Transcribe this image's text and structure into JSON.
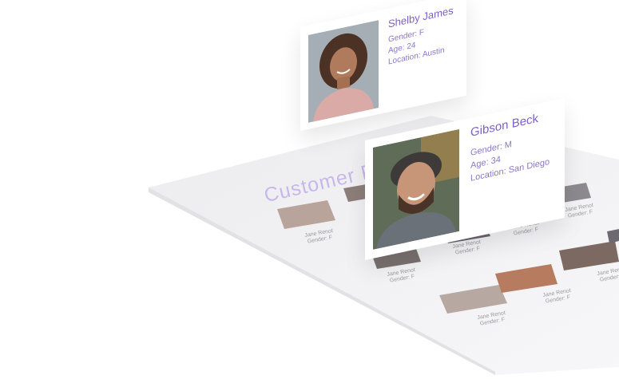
{
  "sheet": {
    "title": "Customer R",
    "tiles": [
      {
        "name": "Jane Renot",
        "gender": "Gender: F"
      },
      {
        "name": "Jane Renot",
        "gender": "Gender: F"
      },
      {
        "name": "Jane Renot",
        "gender": "Gender: F"
      },
      {
        "name": "Jane Renot",
        "gender": "Gender: F"
      },
      {
        "name": "Jane Renot",
        "gender": "Gender: F"
      },
      {
        "name": "Jane Renot",
        "gender": "Gender: F"
      },
      {
        "name": "Jane Renot",
        "gender": "Gender: F"
      },
      {
        "name": "Jane Renot",
        "gender": "Gender: F"
      },
      {
        "name": "Jane Renot",
        "gender": "Gender: F"
      },
      {
        "name": "Jane Renot",
        "gender": "Gender: F"
      },
      {
        "name": "Jane Renot",
        "gender": "Gender: F"
      }
    ]
  },
  "cards": [
    {
      "name": "Shelby James",
      "gender": "Gender: F",
      "age": "Age: 24",
      "location": "Location: Austin"
    },
    {
      "name": "Gibson Beck",
      "gender": "Gender: M",
      "age": "Age: 34",
      "location": "Location: San Diego"
    }
  ],
  "colors": {
    "accent": "#7c5fc4",
    "title": "#c7b7ea",
    "sheet": "#f3f3f5"
  }
}
